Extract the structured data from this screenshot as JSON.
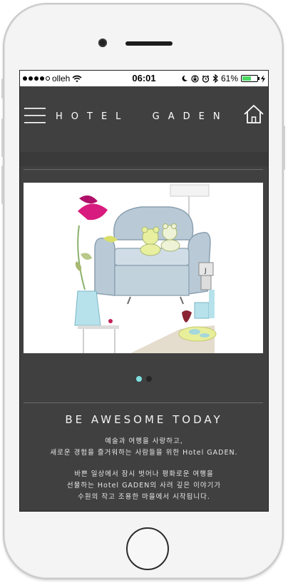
{
  "status_bar": {
    "carrier": "olleh",
    "time": "06:01",
    "battery_percent": "61%",
    "battery_level": 0.61,
    "signal_bars_filled": 4,
    "signal_bars_total": 5,
    "icons": [
      "wifi-icon",
      "moon-icon",
      "rotation-lock-icon",
      "alarm-icon",
      "bluetooth-icon",
      "charging-bolt-icon"
    ]
  },
  "header": {
    "title": "HOTEL  GADEN",
    "menu_icon": "hamburger-menu-icon",
    "home_icon": "home-icon"
  },
  "carousel": {
    "image": "illustrated-lounge-chair-with-teddy-bears",
    "slide_count": 2,
    "active_index": 0
  },
  "content": {
    "tagline": "BE AWESOME TODAY",
    "paragraph1_line1": "예술과 여행을 사랑하고,",
    "paragraph1_line2": "새로운 경험을 즐거워하는 사람들을 위한 Hotel GADEN.",
    "paragraph2_line1": "바쁜 일상에서 잠시 벗어나 평화로운 여행을",
    "paragraph2_line2": "선물하는 Hotel GADEN의 사려 깊은 이야기가",
    "paragraph2_line3": "수원의 작고 조용한 마을에서 시작됩니다."
  },
  "colors": {
    "page_bg": "#404040",
    "accent_dot": "#7fe0e0",
    "battery_green": "#4cd964"
  }
}
